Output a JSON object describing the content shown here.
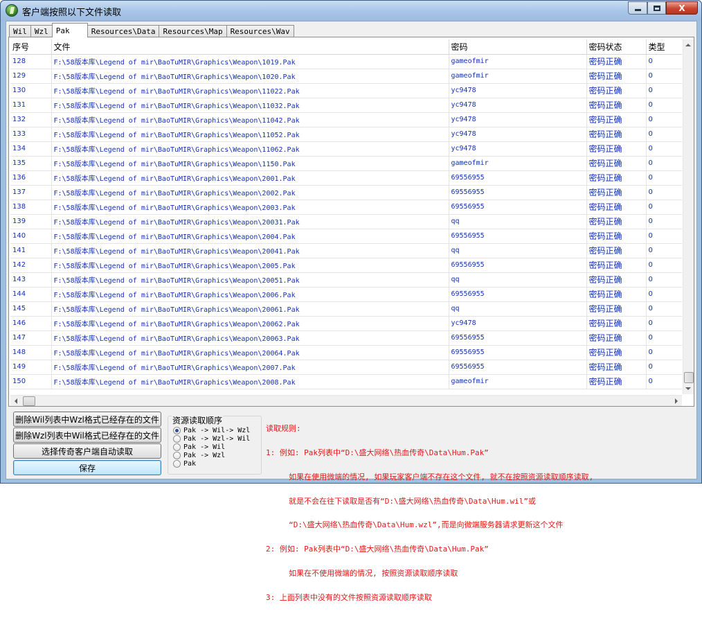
{
  "window": {
    "title": "客户端按照以下文件读取",
    "min_label": "",
    "max_label": "",
    "close_label": "X"
  },
  "tabs": [
    {
      "label": "Wil",
      "active": false
    },
    {
      "label": "Wzl",
      "active": false
    },
    {
      "label": "Pak",
      "active": true
    },
    {
      "label": "Resources\\Data",
      "active": false
    },
    {
      "label": "Resources\\Map",
      "active": false
    },
    {
      "label": "Resources\\Wav",
      "active": false
    }
  ],
  "table": {
    "columns": [
      "序号",
      "文件",
      "密码",
      "密码状态",
      "类型"
    ],
    "rows": [
      [
        "128",
        "F:\\58版本库\\Legend of mir\\BaoTuMIR\\Graphics\\Weapon\\1019.Pak",
        "gameofmir",
        "密码正确",
        "0"
      ],
      [
        "129",
        "F:\\58版本库\\Legend of mir\\BaoTuMIR\\Graphics\\Weapon\\1020.Pak",
        "gameofmir",
        "密码正确",
        "0"
      ],
      [
        "130",
        "F:\\58版本库\\Legend of mir\\BaoTuMIR\\Graphics\\Weapon\\11022.Pak",
        "yc9478",
        "密码正确",
        "0"
      ],
      [
        "131",
        "F:\\58版本库\\Legend of mir\\BaoTuMIR\\Graphics\\Weapon\\11032.Pak",
        "yc9478",
        "密码正确",
        "0"
      ],
      [
        "132",
        "F:\\58版本库\\Legend of mir\\BaoTuMIR\\Graphics\\Weapon\\11042.Pak",
        "yc9478",
        "密码正确",
        "0"
      ],
      [
        "133",
        "F:\\58版本库\\Legend of mir\\BaoTuMIR\\Graphics\\Weapon\\11052.Pak",
        "yc9478",
        "密码正确",
        "0"
      ],
      [
        "134",
        "F:\\58版本库\\Legend of mir\\BaoTuMIR\\Graphics\\Weapon\\11062.Pak",
        "yc9478",
        "密码正确",
        "0"
      ],
      [
        "135",
        "F:\\58版本库\\Legend of mir\\BaoTuMIR\\Graphics\\Weapon\\1150.Pak",
        "gameofmir",
        "密码正确",
        "0"
      ],
      [
        "136",
        "F:\\58版本库\\Legend of mir\\BaoTuMIR\\Graphics\\Weapon\\2001.Pak",
        "69556955",
        "密码正确",
        "0"
      ],
      [
        "137",
        "F:\\58版本库\\Legend of mir\\BaoTuMIR\\Graphics\\Weapon\\2002.Pak",
        "69556955",
        "密码正确",
        "0"
      ],
      [
        "138",
        "F:\\58版本库\\Legend of mir\\BaoTuMIR\\Graphics\\Weapon\\2003.Pak",
        "69556955",
        "密码正确",
        "0"
      ],
      [
        "139",
        "F:\\58版本库\\Legend of mir\\BaoTuMIR\\Graphics\\Weapon\\20031.Pak",
        "qq",
        "密码正确",
        "0"
      ],
      [
        "140",
        "F:\\58版本库\\Legend of mir\\BaoTuMIR\\Graphics\\Weapon\\2004.Pak",
        "69556955",
        "密码正确",
        "0"
      ],
      [
        "141",
        "F:\\58版本库\\Legend of mir\\BaoTuMIR\\Graphics\\Weapon\\20041.Pak",
        "qq",
        "密码正确",
        "0"
      ],
      [
        "142",
        "F:\\58版本库\\Legend of mir\\BaoTuMIR\\Graphics\\Weapon\\2005.Pak",
        "69556955",
        "密码正确",
        "0"
      ],
      [
        "143",
        "F:\\58版本库\\Legend of mir\\BaoTuMIR\\Graphics\\Weapon\\20051.Pak",
        "qq",
        "密码正确",
        "0"
      ],
      [
        "144",
        "F:\\58版本库\\Legend of mir\\BaoTuMIR\\Graphics\\Weapon\\2006.Pak",
        "69556955",
        "密码正确",
        "0"
      ],
      [
        "145",
        "F:\\58版本库\\Legend of mir\\BaoTuMIR\\Graphics\\Weapon\\20061.Pak",
        "qq",
        "密码正确",
        "0"
      ],
      [
        "146",
        "F:\\58版本库\\Legend of mir\\BaoTuMIR\\Graphics\\Weapon\\20062.Pak",
        "yc9478",
        "密码正确",
        "0"
      ],
      [
        "147",
        "F:\\58版本库\\Legend of mir\\BaoTuMIR\\Graphics\\Weapon\\20063.Pak",
        "69556955",
        "密码正确",
        "0"
      ],
      [
        "148",
        "F:\\58版本库\\Legend of mir\\BaoTuMIR\\Graphics\\Weapon\\20064.Pak",
        "69556955",
        "密码正确",
        "0"
      ],
      [
        "149",
        "F:\\58版本库\\Legend of mir\\BaoTuMIR\\Graphics\\Weapon\\2007.Pak",
        "69556955",
        "密码正确",
        "0"
      ],
      [
        "150",
        "F:\\58版本库\\Legend of mir\\BaoTuMIR\\Graphics\\Weapon\\2008.Pak",
        "gameofmir",
        "密码正确",
        "0"
      ]
    ]
  },
  "buttons": {
    "delete_wil": "删除Wil列表中Wzl格式已经存在的文件",
    "delete_wzl": "删除Wzl列表中Wil格式已经存在的文件",
    "select_client": "选择传奇客户端自动读取",
    "save": "保存"
  },
  "order_group": {
    "title": "资源读取顺序",
    "options": [
      {
        "label": "Pak -> Wil-> Wzl",
        "selected": true
      },
      {
        "label": "Pak -> Wzl-> Wil",
        "selected": false
      },
      {
        "label": "Pak -> Wil",
        "selected": false
      },
      {
        "label": "Pak -> Wzl",
        "selected": false
      },
      {
        "label": "Pak",
        "selected": false
      }
    ]
  },
  "rules": {
    "lines": [
      "读取规则:",
      "1: 例如: Pak列表中“D:\\盛大网络\\热血传奇\\Data\\Hum.Pak”",
      "     如果在使用微端的情况, 如果玩家客户端不存在这个文件, 就不在按照资源读取顺序读取,",
      "     就是不会在往下读取是否有“D:\\盛大网络\\热血传奇\\Data\\Hum.wil”或",
      "     “D:\\盛大网络\\热血传奇\\Data\\Hum.wzl”,而是向微端服务器请求更新这个文件",
      "2: 例如: Pak列表中“D:\\盛大网络\\热血传奇\\Data\\Hum.Pak”",
      "     如果在不使用微端的情况, 按照资源读取顺序读取",
      "3: 上面列表中没有的文件按照资源读取顺序读取"
    ]
  },
  "colors": {
    "cell_text": "#1530b0",
    "rules_text": "#e01818",
    "title_bar": "#a9c6e8"
  }
}
